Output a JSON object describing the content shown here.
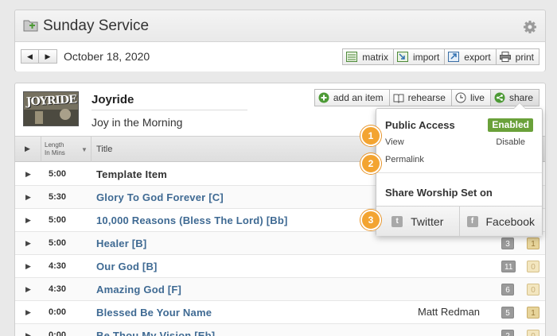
{
  "header": {
    "title": "Sunday Service",
    "date": "October 18, 2020",
    "prev_icon": "◀",
    "next_icon": "▶",
    "toolbar": [
      {
        "label": "matrix",
        "icon": "matrix-icon"
      },
      {
        "label": "import",
        "icon": "import-icon"
      },
      {
        "label": "export",
        "icon": "export-icon"
      },
      {
        "label": "print",
        "icon": "print-icon"
      }
    ]
  },
  "set": {
    "art_text": "JOYRIDE",
    "title": "Joyride",
    "subtitle": "Joy in the Morning",
    "toolbar": [
      {
        "label": "add an item",
        "icon": "plus-circle-icon"
      },
      {
        "label": "rehearse",
        "icon": "book-icon"
      },
      {
        "label": "live",
        "icon": "clock-icon"
      },
      {
        "label": "share",
        "icon": "share-icon"
      }
    ]
  },
  "table": {
    "header_play": "▶",
    "header_length_1": "Length",
    "header_length_2": "In Mins",
    "header_sort": "▼",
    "header_title": "Title",
    "rows": [
      {
        "play": "▶",
        "length": "5:00",
        "title": "Template Item",
        "artist": "",
        "badge_g": "",
        "badge_y": ""
      },
      {
        "play": "▶",
        "length": "5:30",
        "title": "Glory To God Forever [C]",
        "artist": "",
        "badge_g": "",
        "badge_y": ""
      },
      {
        "play": "▶",
        "length": "5:00",
        "title": "10,000 Reasons (Bless The Lord) [Bb]",
        "artist": "",
        "badge_g": "",
        "badge_y": ""
      },
      {
        "play": "▶",
        "length": "5:00",
        "title": "Healer [B]",
        "artist": "",
        "badge_g": "3",
        "badge_y": "1"
      },
      {
        "play": "▶",
        "length": "4:30",
        "title": "Our God [B]",
        "artist": "",
        "badge_g": "11",
        "badge_y": "0"
      },
      {
        "play": "▶",
        "length": "4:30",
        "title": "Amazing God [F]",
        "artist": "",
        "badge_g": "6",
        "badge_y": "0"
      },
      {
        "play": "▶",
        "length": "0:00",
        "title": "Blessed Be Your Name",
        "artist": "Matt Redman",
        "badge_g": "5",
        "badge_y": "1"
      },
      {
        "play": "▶",
        "length": "0:00",
        "title": "Be Thou My Vision [Eb]",
        "artist": "",
        "badge_g": "2",
        "badge_y": "0"
      }
    ]
  },
  "share_dropdown": {
    "public_access": "Public Access",
    "enabled": "Enabled",
    "view": "View",
    "disable": "Disable",
    "permalink": "Permalink",
    "share_title": "Share Worship Set on",
    "twitter": "Twitter",
    "twitter_glyph": "t",
    "facebook": "Facebook",
    "facebook_glyph": "f"
  },
  "callouts": [
    "1",
    "2",
    "3"
  ],
  "colors": {
    "accent_blue": "#3f6a93",
    "enabled_green": "#6aa13a",
    "callout_orange": "#f3a431"
  }
}
